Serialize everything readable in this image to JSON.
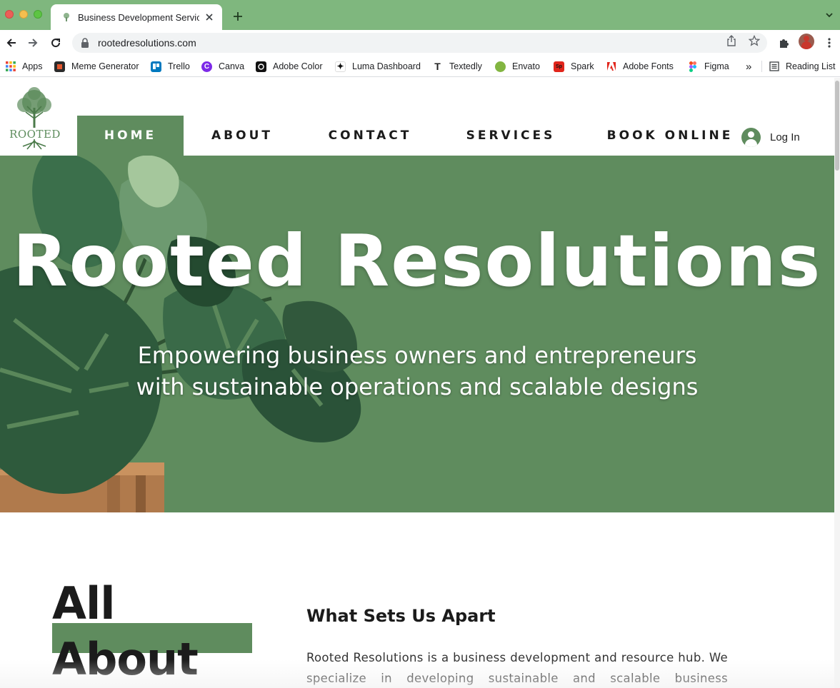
{
  "browser": {
    "tab_title": "Business Development Service",
    "url": "rootedresolutions.com",
    "bookmarks": [
      {
        "label": "Apps",
        "icon": "apps-grid-icon"
      },
      {
        "label": "Meme Generator",
        "icon": "imgflip-icon"
      },
      {
        "label": "Trello",
        "icon": "trello-icon"
      },
      {
        "label": "Canva",
        "icon": "canva-icon"
      },
      {
        "label": "Adobe Color",
        "icon": "adobe-color-icon"
      },
      {
        "label": "Luma Dashboard",
        "icon": "luma-icon"
      },
      {
        "label": "Textedly",
        "icon": "textedly-icon"
      },
      {
        "label": "Envato",
        "icon": "envato-icon"
      },
      {
        "label": "Spark",
        "icon": "spark-icon"
      },
      {
        "label": "Adobe Fonts",
        "icon": "adobe-fonts-icon"
      },
      {
        "label": "Figma",
        "icon": "figma-icon"
      }
    ],
    "overflow_label": "»",
    "reading_list": "Reading List"
  },
  "site": {
    "logo_text": "ROOTED",
    "nav": [
      "HOME",
      "ABOUT",
      "CONTACT",
      "SERVICES",
      "BOOK ONLINE"
    ],
    "active_nav": "HOME",
    "login_label": "Log In",
    "hero": {
      "title": "Rooted Resolutions",
      "subtitle_line1": "Empowering business owners and entrepreneurs",
      "subtitle_line2": "with sustainable operations and scalable designs"
    },
    "about": {
      "heading_line1": "All",
      "heading_line2": "About",
      "section_title": "What Sets Us Apart",
      "body": "Rooted Resolutions is a business development and resource hub. We specialize in developing sustainable and scalable business operations"
    }
  },
  "colors": {
    "brand_green": "#5f8c5e",
    "tabstrip_green": "#7fb77e"
  }
}
